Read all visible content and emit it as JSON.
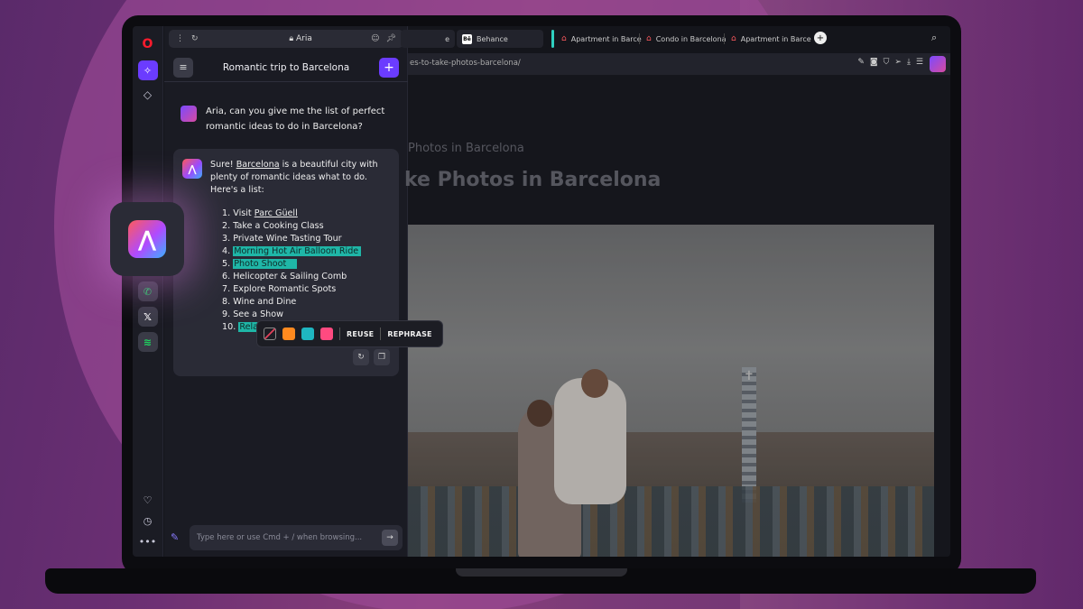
{
  "rail": {
    "logo": "O",
    "aria_icon": "✧",
    "diamond_icon": "◇",
    "apps": [
      {
        "name": "whatsapp-icon",
        "glyph": "✆",
        "color": "#25d366"
      },
      {
        "name": "x-icon",
        "glyph": "𝕏",
        "color": "#ffffff"
      },
      {
        "name": "spotify-icon",
        "glyph": "≋",
        "color": "#1ed760"
      }
    ],
    "bottom": [
      "♡",
      "◷",
      "•••"
    ]
  },
  "panel": {
    "address": "Aria",
    "title": "Romantic trip to Barcelona",
    "user_message": "Aria, can you give me the list of perfect romantic ideas to do in Barcelona?",
    "bot_intro_pre": "Sure! ",
    "bot_intro_link": "Barcelona",
    "bot_intro_post": " is a beautiful city with plenty of romantic ideas what to do. Here's a list:",
    "list": [
      {
        "n": "1.",
        "pre": "Visit ",
        "link": "Parc Güell",
        "text": "",
        "hl": false
      },
      {
        "n": "2.",
        "pre": "",
        "link": "",
        "text": "Take a Cooking Class",
        "hl": false
      },
      {
        "n": "3.",
        "pre": "",
        "link": "",
        "text": "Private Wine Tasting Tour",
        "hl": false
      },
      {
        "n": "4.",
        "pre": "",
        "link": "",
        "text": "Morning Hot Air Balloon Ride",
        "hl": true
      },
      {
        "n": "5.",
        "pre": "",
        "link": "",
        "text": "Photo Shoot",
        "hl": true
      },
      {
        "n": "6.",
        "pre": "",
        "link": "",
        "text": "Helicopter & Sailing Comb",
        "hl": false
      },
      {
        "n": "7.",
        "pre": "",
        "link": "",
        "text": "Explore Romantic Spots",
        "hl": false
      },
      {
        "n": "8.",
        "pre": "",
        "link": "",
        "text": "Wine and Dine",
        "hl": false
      },
      {
        "n": "9.",
        "pre": "",
        "link": "",
        "text": "See a Show",
        "hl": false
      },
      {
        "n": "10.",
        "pre": "",
        "link": "",
        "text": "Relax in",
        "hl": true
      }
    ],
    "input_placeholder": "Type here or use Cmd + / when browsing..."
  },
  "toolbar": {
    "reuse": "REUSE",
    "rephrase": "REPHRASE",
    "colors": [
      "#ff8a1f",
      "#1fb6c0",
      "#ff4a80"
    ]
  },
  "tabs": [
    {
      "label": "e"
    },
    {
      "label": "Behance"
    },
    {
      "label": "Apartment in Barce"
    },
    {
      "label": "Condo in Barcelona"
    },
    {
      "label": "Apartment in Barce"
    }
  ],
  "url": "es-to-take-photos-barcelona/",
  "page": {
    "subtitle": "Photos in Barcelona",
    "heading": "ke Photos in Barcelona"
  }
}
